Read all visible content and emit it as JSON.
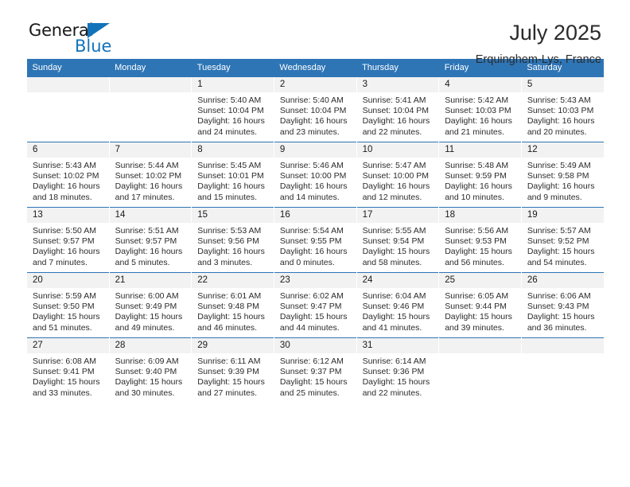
{
  "brand": {
    "name_top": "General",
    "name_bottom": "Blue",
    "accent_color": "#1273ba"
  },
  "header": {
    "title": "July 2025",
    "subtitle": "Erquinghem-Lys, France"
  },
  "theme": {
    "header_blue": "#2e75b6",
    "daynum_band": "#f2f2f2"
  },
  "weekday_headers": [
    "Sunday",
    "Monday",
    "Tuesday",
    "Wednesday",
    "Thursday",
    "Friday",
    "Saturday"
  ],
  "labels": {
    "sunrise_prefix": "Sunrise:",
    "sunset_prefix": "Sunset:",
    "daylight_prefix": "Daylight:"
  },
  "weeks": [
    [
      {
        "day": "",
        "empty": true
      },
      {
        "day": "",
        "empty": true
      },
      {
        "day": "1",
        "sunrise": "Sunrise: 5:40 AM",
        "sunset": "Sunset: 10:04 PM",
        "daylight_1": "Daylight: 16 hours",
        "daylight_2": "and 24 minutes."
      },
      {
        "day": "2",
        "sunrise": "Sunrise: 5:40 AM",
        "sunset": "Sunset: 10:04 PM",
        "daylight_1": "Daylight: 16 hours",
        "daylight_2": "and 23 minutes."
      },
      {
        "day": "3",
        "sunrise": "Sunrise: 5:41 AM",
        "sunset": "Sunset: 10:04 PM",
        "daylight_1": "Daylight: 16 hours",
        "daylight_2": "and 22 minutes."
      },
      {
        "day": "4",
        "sunrise": "Sunrise: 5:42 AM",
        "sunset": "Sunset: 10:03 PM",
        "daylight_1": "Daylight: 16 hours",
        "daylight_2": "and 21 minutes."
      },
      {
        "day": "5",
        "sunrise": "Sunrise: 5:43 AM",
        "sunset": "Sunset: 10:03 PM",
        "daylight_1": "Daylight: 16 hours",
        "daylight_2": "and 20 minutes."
      }
    ],
    [
      {
        "day": "6",
        "sunrise": "Sunrise: 5:43 AM",
        "sunset": "Sunset: 10:02 PM",
        "daylight_1": "Daylight: 16 hours",
        "daylight_2": "and 18 minutes."
      },
      {
        "day": "7",
        "sunrise": "Sunrise: 5:44 AM",
        "sunset": "Sunset: 10:02 PM",
        "daylight_1": "Daylight: 16 hours",
        "daylight_2": "and 17 minutes."
      },
      {
        "day": "8",
        "sunrise": "Sunrise: 5:45 AM",
        "sunset": "Sunset: 10:01 PM",
        "daylight_1": "Daylight: 16 hours",
        "daylight_2": "and 15 minutes."
      },
      {
        "day": "9",
        "sunrise": "Sunrise: 5:46 AM",
        "sunset": "Sunset: 10:00 PM",
        "daylight_1": "Daylight: 16 hours",
        "daylight_2": "and 14 minutes."
      },
      {
        "day": "10",
        "sunrise": "Sunrise: 5:47 AM",
        "sunset": "Sunset: 10:00 PM",
        "daylight_1": "Daylight: 16 hours",
        "daylight_2": "and 12 minutes."
      },
      {
        "day": "11",
        "sunrise": "Sunrise: 5:48 AM",
        "sunset": "Sunset: 9:59 PM",
        "daylight_1": "Daylight: 16 hours",
        "daylight_2": "and 10 minutes."
      },
      {
        "day": "12",
        "sunrise": "Sunrise: 5:49 AM",
        "sunset": "Sunset: 9:58 PM",
        "daylight_1": "Daylight: 16 hours",
        "daylight_2": "and 9 minutes."
      }
    ],
    [
      {
        "day": "13",
        "sunrise": "Sunrise: 5:50 AM",
        "sunset": "Sunset: 9:57 PM",
        "daylight_1": "Daylight: 16 hours",
        "daylight_2": "and 7 minutes."
      },
      {
        "day": "14",
        "sunrise": "Sunrise: 5:51 AM",
        "sunset": "Sunset: 9:57 PM",
        "daylight_1": "Daylight: 16 hours",
        "daylight_2": "and 5 minutes."
      },
      {
        "day": "15",
        "sunrise": "Sunrise: 5:53 AM",
        "sunset": "Sunset: 9:56 PM",
        "daylight_1": "Daylight: 16 hours",
        "daylight_2": "and 3 minutes."
      },
      {
        "day": "16",
        "sunrise": "Sunrise: 5:54 AM",
        "sunset": "Sunset: 9:55 PM",
        "daylight_1": "Daylight: 16 hours",
        "daylight_2": "and 0 minutes."
      },
      {
        "day": "17",
        "sunrise": "Sunrise: 5:55 AM",
        "sunset": "Sunset: 9:54 PM",
        "daylight_1": "Daylight: 15 hours",
        "daylight_2": "and 58 minutes."
      },
      {
        "day": "18",
        "sunrise": "Sunrise: 5:56 AM",
        "sunset": "Sunset: 9:53 PM",
        "daylight_1": "Daylight: 15 hours",
        "daylight_2": "and 56 minutes."
      },
      {
        "day": "19",
        "sunrise": "Sunrise: 5:57 AM",
        "sunset": "Sunset: 9:52 PM",
        "daylight_1": "Daylight: 15 hours",
        "daylight_2": "and 54 minutes."
      }
    ],
    [
      {
        "day": "20",
        "sunrise": "Sunrise: 5:59 AM",
        "sunset": "Sunset: 9:50 PM",
        "daylight_1": "Daylight: 15 hours",
        "daylight_2": "and 51 minutes."
      },
      {
        "day": "21",
        "sunrise": "Sunrise: 6:00 AM",
        "sunset": "Sunset: 9:49 PM",
        "daylight_1": "Daylight: 15 hours",
        "daylight_2": "and 49 minutes."
      },
      {
        "day": "22",
        "sunrise": "Sunrise: 6:01 AM",
        "sunset": "Sunset: 9:48 PM",
        "daylight_1": "Daylight: 15 hours",
        "daylight_2": "and 46 minutes."
      },
      {
        "day": "23",
        "sunrise": "Sunrise: 6:02 AM",
        "sunset": "Sunset: 9:47 PM",
        "daylight_1": "Daylight: 15 hours",
        "daylight_2": "and 44 minutes."
      },
      {
        "day": "24",
        "sunrise": "Sunrise: 6:04 AM",
        "sunset": "Sunset: 9:46 PM",
        "daylight_1": "Daylight: 15 hours",
        "daylight_2": "and 41 minutes."
      },
      {
        "day": "25",
        "sunrise": "Sunrise: 6:05 AM",
        "sunset": "Sunset: 9:44 PM",
        "daylight_1": "Daylight: 15 hours",
        "daylight_2": "and 39 minutes."
      },
      {
        "day": "26",
        "sunrise": "Sunrise: 6:06 AM",
        "sunset": "Sunset: 9:43 PM",
        "daylight_1": "Daylight: 15 hours",
        "daylight_2": "and 36 minutes."
      }
    ],
    [
      {
        "day": "27",
        "sunrise": "Sunrise: 6:08 AM",
        "sunset": "Sunset: 9:41 PM",
        "daylight_1": "Daylight: 15 hours",
        "daylight_2": "and 33 minutes."
      },
      {
        "day": "28",
        "sunrise": "Sunrise: 6:09 AM",
        "sunset": "Sunset: 9:40 PM",
        "daylight_1": "Daylight: 15 hours",
        "daylight_2": "and 30 minutes."
      },
      {
        "day": "29",
        "sunrise": "Sunrise: 6:11 AM",
        "sunset": "Sunset: 9:39 PM",
        "daylight_1": "Daylight: 15 hours",
        "daylight_2": "and 27 minutes."
      },
      {
        "day": "30",
        "sunrise": "Sunrise: 6:12 AM",
        "sunset": "Sunset: 9:37 PM",
        "daylight_1": "Daylight: 15 hours",
        "daylight_2": "and 25 minutes."
      },
      {
        "day": "31",
        "sunrise": "Sunrise: 6:14 AM",
        "sunset": "Sunset: 9:36 PM",
        "daylight_1": "Daylight: 15 hours",
        "daylight_2": "and 22 minutes."
      },
      {
        "day": "",
        "empty": true
      },
      {
        "day": "",
        "empty": true
      }
    ]
  ]
}
